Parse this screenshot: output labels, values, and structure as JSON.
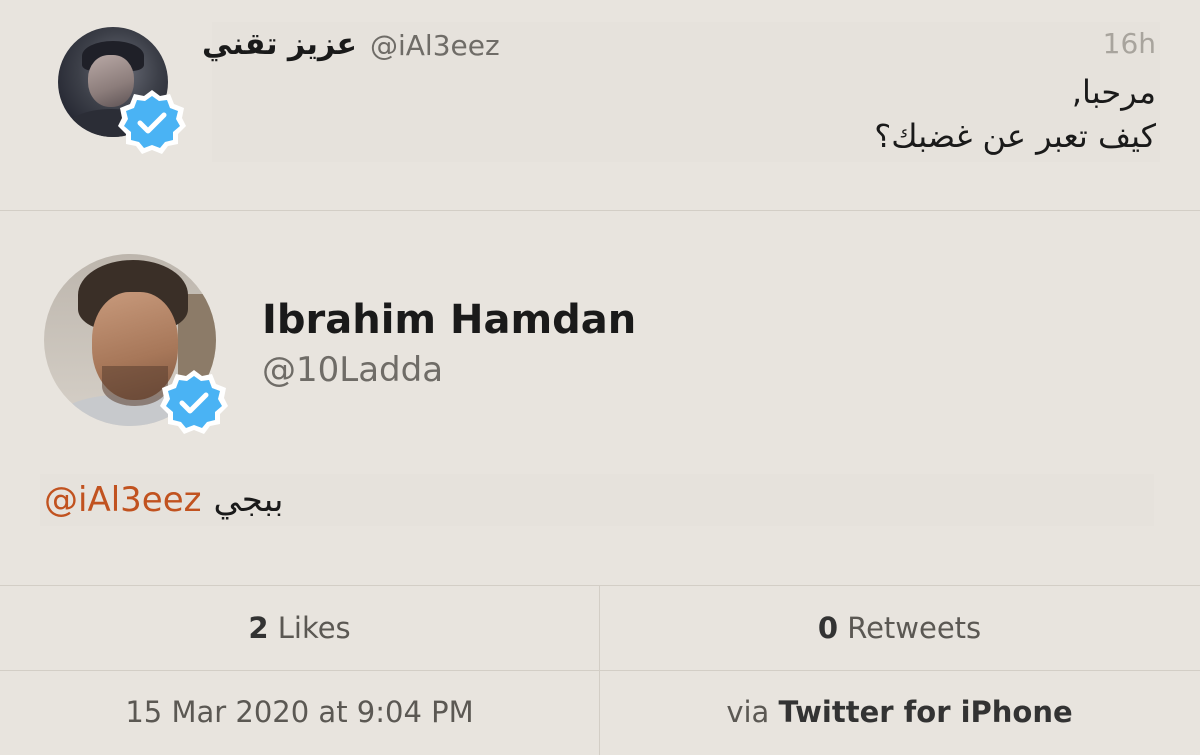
{
  "parent_tweet": {
    "display_name": "عزيز تقني",
    "handle": "@iAl3eez",
    "time": "16h",
    "text_line1": "مرحبا,",
    "text_line2": "كيف تعبر عن غضبك؟",
    "avatar_icon": "profile-photo",
    "verified_icon": "verified-badge-icon"
  },
  "main_tweet": {
    "display_name": "Ibrahim Hamdan",
    "handle": "@10Ladda",
    "text_word": "ببجي",
    "text_mention": "@iAl3eez",
    "avatar_icon": "profile-photo",
    "verified_icon": "verified-badge-icon"
  },
  "stats": {
    "likes_count": "2",
    "likes_label": "Likes",
    "retweets_count": "0",
    "retweets_label": "Retweets",
    "date": "15 Mar 2020 at 9:04 PM",
    "via_prefix": "via",
    "via_app": "Twitter for iPhone"
  },
  "colors": {
    "background": "#e8e4de",
    "mention": "#c1521f",
    "verified": "#4ab3f4",
    "muted": "#6f6c67",
    "divider": "#d3cec6"
  }
}
